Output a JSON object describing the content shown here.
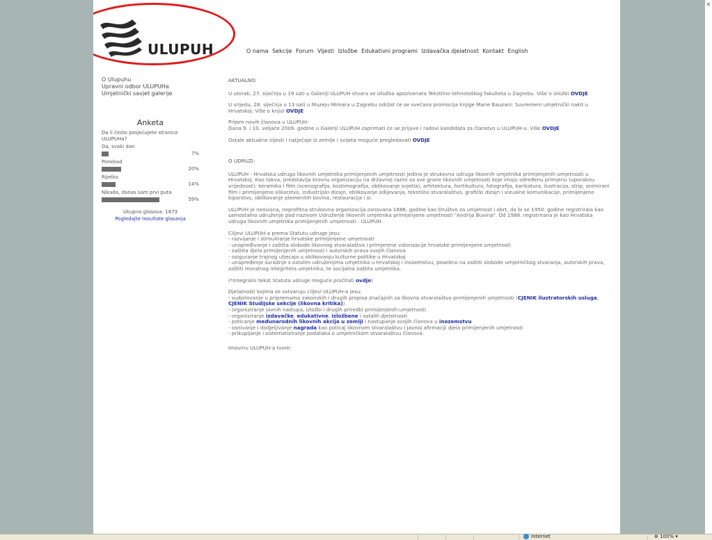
{
  "logo": {
    "text": "ULUPUH"
  },
  "topnav": {
    "items": [
      "O nama",
      "Sekcije",
      "Forum",
      "Vijesti",
      "Izložbe",
      "Edukativni programi",
      "Izdavačka djelatnost",
      "Kontakt",
      "English"
    ]
  },
  "leftnav": {
    "items": [
      "O Ulupuhu",
      "Upravni odbor ULUPUHa",
      "Umjetnički savjet galerije"
    ]
  },
  "poll": {
    "title": "Anketa",
    "question": "Da li često posjećujete stranice ULUPUHa?",
    "options": [
      {
        "label": "Da, svaki dan",
        "percent": "7%",
        "fraction": 0.07
      },
      {
        "label": "Ponekad",
        "percent": "20%",
        "fraction": 0.2
      },
      {
        "label": "Rijetko",
        "percent": "14%",
        "fraction": 0.14
      },
      {
        "label": "Nikada, danas sam prvi puta",
        "percent": "59%",
        "fraction": 0.59
      }
    ],
    "total": "Ukupno glasova: 1873",
    "results_link": "Pogledajte rezultate glasanja"
  },
  "content": {
    "aktualno_heading": "AKTUALNO:",
    "news1_text": "U utorak, 27. siječnja u 19 sati u Galeriji ULUPUH otvara se izložba apsolvenata Tekstilno-tehnološkog fakulteta u Zagrebu. Više o izložbi ",
    "news1_link": "OVDJE",
    "news2_text": "U srijedu, 28. siječnja u 13 sati u Muzeju Mimara u Zagrebu održat će se svečana promocija knjige Marie Bauzani: Suvremeni umjetnički nakit u Hrvatskoj. Više o knjizi ",
    "news2_link": "OVDJE",
    "news3_line1": "Prijem novih članova u ULUPUH:",
    "news3_text": "Dana 9. i 10. veljače 2009. godine u Galeriji ULUPUH zaprimati će se prijave i radovi kandidata za članstvo u ULUPUH-u. Više ",
    "news3_link": "OVDJE",
    "news4_text": "Ostale aktualne vijesti i natječaje iz zemlje i svijeta moguće pregledavati ",
    "news4_link": "OVDJE",
    "udruzi_heading": "O UDRUZI:",
    "about1": "ULUPUH - Hrvatska udruga likovnih umjetnika primijenjenih umjetnosti jedina je strukovna udruga likovnih umjetnika primijenjenih umjetnosti u Hrvatskoj. Kao takva, predstavlja krovnu organizaciju na državnoj razini za sve grane likovnih umjetnosti koje imaju određenu primjenu (uporabnu vrijednost): keramika i film (scenografija, kostimografija, oblikovanje svjetla), arhitektura, hortikultura, fotografija, karikatura, ilustracija, strip, animirani film i primijenjeno slikarstvo, industrijski dizajn, oblikovanje odijevanja, tekstilno stvaralaštvo, grafički dizajn i vizualne komunikacije, primijenjeno kiparstvo, oblikovanje plemenitih kovina, restauracija i sl.",
    "about2": "ULUPUH je neovisna, neprofitna strukovna organizacija osnovana 1886. godine kao Društvo za umjetnost i obrt, da bi se 1950. godine registrirala kao samostalno udruženje pod nazivom Udruženje likovnih umjetnika primijenjene umjetnosti \"Andrija Buvina\". Od 1988. registrirana je kao Hrvatska udruga likovnih umjetnika primijenjenih umjetnosti - ULUPUH.",
    "goals_intro": "Ciljevi ULUPUH-a prema Statutu udruge jesu:",
    "goals": [
      "- razvijanje i stimuliranje hrvatske primijenjene umjetnosti",
      "- unapređivanje i zaštita slobode likovnog stvaralaštva i primjerene valorizacije hrvatske primijenjene umjetnosti",
      "- zaštita djela primijenjenih umjetnosti i autorskih prava svojih članova",
      "- osiguranje trajnog utjecaja u oblikovanju kulturne politike u Hrvatskoj",
      "- unapređenje suradnje s ostalim udruženjima umjetnika u Hrvatskoj i inozemstvu, posebno na zaštiti slobode umjetničkog stvaranja, autorskih prava, zaštiti moralnog integriteta umjetnika, te socijalna zaštita umjetnika."
    ],
    "statute_text": "(*Integralni tekst Statuta udruge moguće pročitati ",
    "statute_link": "ovdje",
    "statute_end": ")",
    "activities_intro": "Djelatnosti kojima se ostvaruju ciljevi ULUPUH-a jesu:",
    "act1_text": "- sudjelovanje u pripremama zakonskih i drugih propisa značajnih za likovno stvaralaštvo primijenjenih umjetnosti (",
    "act1_link1": "CJENIK ilustratorskih usluga",
    "act1_mid": ", ",
    "act1_link2": "CJENIK Studijske sekcije (likovna kritika)",
    "act1_end": ")",
    "act2": "- organiziranje javnih nastupa, izložbi i drugih priredbi primijenjenih umjetnosti",
    "act3_text": "- organiziranje ",
    "act3_link1": "izdavačke",
    "act3_link2": "edukativne",
    "act3_link3": "izložbene",
    "act3_end": " i ostalih djelatnosti",
    "act4_text": "- poticanje ",
    "act4_link1": "međunarodnih likovnih akcija u zemlji",
    "act4_mid": " i nastupanje svojih članova u ",
    "act4_link2": "inozemstvu",
    "act5_text": "- osnivanje i dodjeljivanje ",
    "act5_link": "nagrada",
    "act5_end": " kao poticaj likovnom stvaralaštvu i javnoj afirmaciji djela primijenjenih umjetnosti",
    "act6": "- prikupljanje i sistematiziranje podataka o umjetničkom stvaralaštvu članova.",
    "imovina": "Imovinu ULUPUH-a tvore:"
  },
  "statusbar": {
    "zone": "Internet",
    "zoom": "100%"
  }
}
